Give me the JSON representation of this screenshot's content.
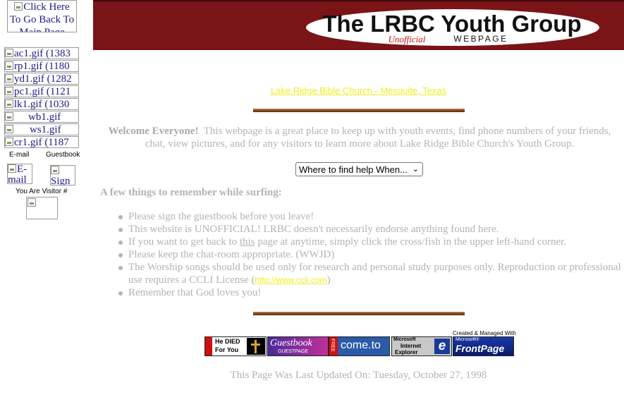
{
  "sidebar": {
    "home_button": "Click Here To Go Back To Main Page",
    "nav_images": [
      "ac1.gif (1383",
      "rp1.gif (1180",
      "yd1.gif (1282",
      "pc1.gif (1121",
      "lk1.gif (1030",
      "wb1.gif",
      "ws1.gif",
      "cr1.gif (1187"
    ],
    "email_label": "E-mail",
    "guestbook_label": "Guestbook",
    "email_button": "E-mail",
    "sign_button": "Sign",
    "visitor_label": "You Are Visitor #"
  },
  "banner": {
    "title": "The LRBC Youth Group",
    "unofficial": "Unofficial",
    "subtitle": "WEBPAGE"
  },
  "main": {
    "church_link": "Lake Ridge Bible Church - Mesquite, Texas",
    "welcome_bold": "Welcome Everyone!",
    "welcome_text": "This webpage is a great place to keep up with youth events, find phone numbers of your friends, chat, view pictures, and for any visitors to learn more about Lake Ridge Bible Church's Youth Group.",
    "help_select": "Where to find help When...",
    "remember_heading": "A few things to remember while surfing:",
    "tips": [
      "Please sign the guestbook before you leave!",
      "This website is UNOFFICIAL!  LRBC doesn't necessarily endorse anything found here.",
      "If you want to get back to",
      "this",
      "page at anytime, simply click the cross/fish in the upper left-hand corner.",
      "Please keep the chat-room appropriate. (WWJD)",
      "The Worship songs should be used only for research and personal study purposes only.  Reproduction or professional use requires a CCLI License (",
      "http://www.ccli.com",
      ")",
      "Remember that God loves you!"
    ],
    "badges": {
      "died_line1": "He DIED",
      "died_line2": "For You",
      "guestbook": "Guestbook",
      "guestbook_sub": "GUESTPAGE",
      "free": "FREE",
      "cometo": "come.to",
      "ie_line1": "Microsoft",
      "ie_line2": "Internet",
      "ie_line3": "Explorer",
      "created_label": "Created & Managed With",
      "fp_line1": "Microsoft®",
      "fp_line2": "FrontPage"
    },
    "last_updated": "This Page Was Last Updated On:  Tuesday, October 27, 1998"
  },
  "colors": {
    "banner": "#7a1416",
    "link": "#eeee22",
    "body_text": "#b3b3b3"
  }
}
